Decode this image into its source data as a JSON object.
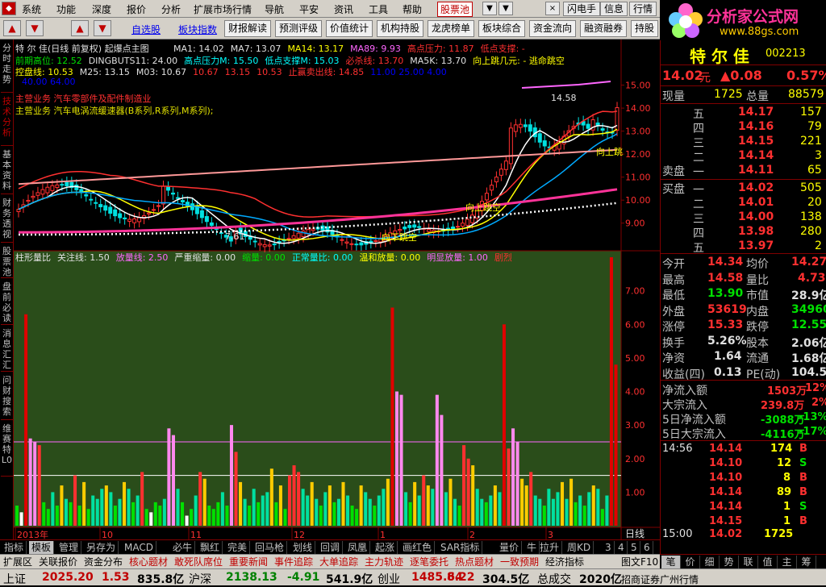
{
  "menu": [
    "系统",
    "功能",
    "深度",
    "报价",
    "分析",
    "扩展市场行情",
    "导航",
    "平安",
    "资讯",
    "工具",
    "帮助"
  ],
  "menu_highlight": "股票池",
  "right_menu": [
    "闪电手",
    "信息",
    "行情"
  ],
  "window_buttons": [
    "▼",
    "▼",
    "×"
  ],
  "logo": {
    "brand": "分析家公式网",
    "url": "www.88gs.com"
  },
  "toolbar": {
    "links": [
      "自选股",
      "板块指数"
    ],
    "buttons": [
      "财报解读",
      "预测评级",
      "价值统计",
      "机构持股",
      "龙虎榜单",
      "板块综合",
      "资金流向",
      "融资融券",
      "持股变"
    ]
  },
  "left_tabs": [
    {
      "label": "分时走势",
      "active": false
    },
    {
      "label": "技术分析",
      "active": true
    },
    {
      "label": "基本资料",
      "active": false
    },
    {
      "label": "财务透视",
      "active": false
    },
    {
      "label": "股票池",
      "active": false
    },
    {
      "label": "盘前必读",
      "active": false
    },
    {
      "label": "消息汇汇",
      "active": false
    },
    {
      "label": "问财搜索",
      "active": false
    },
    {
      "label": "维赛特L0",
      "active": false
    }
  ],
  "main_chart": {
    "title": "特 尔 佳(日线 前复权) 起爆点主图",
    "legend1": [
      {
        "t": "MA1: 14.02",
        "c": "#e0e0e0"
      },
      {
        "t": "MA7: 13.07",
        "c": "#e0e0e0"
      },
      {
        "t": "MA14: 13.17",
        "c": "#ffff00"
      },
      {
        "t": "MA89: 9.93",
        "c": "#ff66ff"
      },
      {
        "t": "高点压力: 11.87",
        "c": "#ff3030"
      },
      {
        "t": "低点支撑: -",
        "c": "#ff3030"
      }
    ],
    "legend2": [
      {
        "t": "前期高位: 12.52",
        "c": "#00e000"
      },
      {
        "t": "DINGBUTS11: 24.00",
        "c": "#e0e0e0"
      },
      {
        "t": "高点压力M: 15.50",
        "c": "#00ffff"
      },
      {
        "t": "低点支撑M: 15.03",
        "c": "#00ffff"
      },
      {
        "t": "必杀线: 13.70",
        "c": "#ff3030"
      },
      {
        "t": "MA5K: 13.70",
        "c": "#e0e0e0"
      },
      {
        "t": "向上跳几元: - 逃命跳空",
        "c": "#ffff00"
      }
    ],
    "legend3": [
      {
        "t": "控盘线: 10.53",
        "c": "#ffff00"
      },
      {
        "t": "M25: 13.15",
        "c": "#e0e0e0"
      },
      {
        "t": "M03: 10.67",
        "c": "#e0e0e0"
      },
      {
        "t": "10.67",
        "c": "#ff3030"
      },
      {
        "t": "13.15",
        "c": "#ff3030"
      },
      {
        "t": "10.53",
        "c": "#ff3030"
      },
      {
        "t": "止赢卖出线: 14.85",
        "c": "#ff3030"
      },
      {
        "t": "11.00 25.00 4.00",
        "c": "#0000ff"
      }
    ],
    "legend4": {
      "t": "40.00 64.00",
      "c": "#0000ff"
    },
    "note1": "主营业务 汽车电涡流缓速器(B系列,R系列,M系列);",
    "note2": "主营业务 汽车零部件及配件制造业",
    "y_labels": [
      "15.00",
      "14.00",
      "13.00",
      "12.00",
      "11.00",
      "10.00",
      "9.00"
    ],
    "annot": {
      "high": "14.58",
      "low": "7.61",
      "up": "向上跳空",
      "up2": "向上跳",
      "down": "向下跳空"
    }
  },
  "sub_chart": {
    "legend": [
      {
        "t": "柱形量比",
        "c": "#e0e0e0"
      },
      {
        "t": "关注线: 1.50",
        "c": "#e0e0e0"
      },
      {
        "t": "放量线: 2.50",
        "c": "#ff66ff"
      },
      {
        "t": "严重缩量: 0.00",
        "c": "#e0e0e0"
      },
      {
        "t": "缩量: 0.00",
        "c": "#00e000"
      },
      {
        "t": "正常量比: 0.00",
        "c": "#00ffff"
      },
      {
        "t": "温和放量: 0.00",
        "c": "#ffff00"
      },
      {
        "t": "明显放量: 1.00",
        "c": "#ff66ff"
      },
      {
        "t": "剧烈",
        "c": "#ff3030"
      }
    ],
    "y_labels": [
      "7.00",
      "6.00",
      "5.00",
      "4.00",
      "3.00",
      "2.00",
      "1.00"
    ],
    "x_labels": [
      "2013年",
      "10",
      "11",
      "12",
      "1",
      "2",
      "3"
    ],
    "x_unit": "日线"
  },
  "chart_data": {
    "type": "bar",
    "title": "柱形量比",
    "ylim": [
      0,
      8
    ],
    "values": [
      0.6,
      0.4,
      6.3,
      2.6,
      2.5,
      2.4,
      0.7,
      0.5,
      1.0,
      0.6,
      1.2,
      0.8,
      0.7,
      1.5,
      0.6,
      1.3,
      0.5,
      0.9,
      0.8,
      1.1,
      1.2,
      1.0,
      0.6,
      0.8,
      1.3,
      1.1,
      0.7,
      0.9,
      1.6,
      0.5,
      0.4,
      0.7,
      0.6,
      0.8,
      2.9,
      2.7,
      1.1,
      0.7,
      0.3,
      0.5,
      0.9,
      1.6,
      1.4,
      0.6,
      0.5,
      0.7,
      1.0,
      0.6,
      3.0,
      2.2,
      1.3,
      0.8,
      0.6,
      1.1,
      0.7,
      0.9,
      1.0,
      1.7,
      0.7,
      1.2,
      0.5,
      1.5,
      1.8,
      1.6,
      1.1,
      0.9,
      1.3,
      0.8,
      0.6,
      1.0,
      1.2,
      0.7,
      0.8,
      1.3,
      0.9,
      0.6,
      0.5,
      1.2,
      1.0,
      0.8,
      0.6,
      0.9,
      1.1,
      1.4,
      6.5,
      4.0,
      3.9,
      1.0,
      0.7,
      1.3,
      0.9,
      1.5,
      1.2,
      1.1,
      3.9,
      3.3,
      1.0,
      1.4,
      0.8,
      0.6,
      2.4,
      2.0,
      1.8,
      1.1,
      0.8,
      0.7,
      0.9,
      1.2,
      1.0,
      6.0,
      2.3,
      2.9,
      2.5,
      1.4,
      1.2,
      1.6,
      0.9,
      0.8,
      0.6,
      1.1,
      0.8,
      1.0,
      1.3,
      0.8,
      1.4,
      0.7,
      0.9,
      0.6,
      1.0,
      1.2,
      1.1,
      0.5,
      0.9,
      8.0,
      4.8
    ],
    "lines": [
      {
        "name": "关注线",
        "value": 1.5
      },
      {
        "name": "放量线",
        "value": 2.5
      }
    ]
  },
  "quote": {
    "name": "特 尔 佳",
    "code": "002213",
    "price": "14.02",
    "unit": "元",
    "change": "▲0.08",
    "pct": "0.57%",
    "xianliang_label": "现量",
    "xianliang": "1725",
    "zongliang_label": "总量",
    "zongliang": "88579",
    "sell_label": "卖盘",
    "buy_label": "买盘",
    "sells": [
      {
        "n": "五",
        "p": "14.17",
        "v": "157"
      },
      {
        "n": "四",
        "p": "14.16",
        "v": "79"
      },
      {
        "n": "三",
        "p": "14.15",
        "v": "221"
      },
      {
        "n": "二",
        "p": "14.14",
        "v": "3"
      },
      {
        "n": "一",
        "p": "14.11",
        "v": "65"
      }
    ],
    "buys": [
      {
        "n": "一",
        "p": "14.02",
        "v": "505"
      },
      {
        "n": "二",
        "p": "14.01",
        "v": "20"
      },
      {
        "n": "三",
        "p": "14.00",
        "v": "138"
      },
      {
        "n": "四",
        "p": "13.98",
        "v": "280"
      },
      {
        "n": "五",
        "p": "13.97",
        "v": "2"
      }
    ],
    "stats": [
      {
        "l1": "今开",
        "v1": "14.34",
        "c1": "red",
        "l2": "均价",
        "v2": "14.27",
        "c2": "red"
      },
      {
        "l1": "最高",
        "v1": "14.58",
        "c1": "red",
        "l2": "量比",
        "v2": "4.73",
        "c2": "red"
      },
      {
        "l1": "最低",
        "v1": "13.90",
        "c1": "grn",
        "l2": "市值",
        "v2": "28.9亿",
        "c2": "wht"
      },
      {
        "l1": "外盘",
        "v1": "53619",
        "c1": "red",
        "l2": "内盘",
        "v2": "34960",
        "c2": "grn"
      },
      {
        "l1": "涨停",
        "v1": "15.33",
        "c1": "red",
        "l2": "跌停",
        "v2": "12.55",
        "c2": "grn"
      },
      {
        "l1": "换手",
        "v1": "5.26%",
        "c1": "wht",
        "l2": "股本",
        "v2": "2.06亿",
        "c2": "wht"
      },
      {
        "l1": "净资",
        "v1": "1.64",
        "c1": "wht",
        "l2": "流通",
        "v2": "1.68亿",
        "c2": "wht"
      },
      {
        "l1": "收益(四)",
        "v1": "0.13",
        "c1": "wht",
        "l2": "PE(动)",
        "v2": "104.5",
        "c2": "wht"
      }
    ],
    "flows": [
      {
        "l": "净流入额",
        "v": "1503万",
        "p": "12%",
        "c": "red"
      },
      {
        "l": "大宗流入",
        "v": "239.8万",
        "p": "2%",
        "c": "red"
      },
      {
        "l": "5日净流入额",
        "v": "-3088万",
        "p": "-13%",
        "c": "grn"
      },
      {
        "l": "5日大宗流入",
        "v": "-4116万",
        "p": "-17%",
        "c": "grn"
      }
    ],
    "ticks": [
      {
        "t": "14:56",
        "p": "14.14",
        "v": "174",
        "d": "B",
        "dc": "red"
      },
      {
        "t": "",
        "p": "14.10",
        "v": "12",
        "d": "S",
        "dc": "grn"
      },
      {
        "t": "",
        "p": "14.10",
        "v": "8",
        "d": "B",
        "dc": "red"
      },
      {
        "t": "",
        "p": "14.14",
        "v": "89",
        "d": "B",
        "dc": "red"
      },
      {
        "t": "",
        "p": "14.14",
        "v": "1",
        "d": "S",
        "dc": "grn"
      },
      {
        "t": "",
        "p": "14.15",
        "v": "1",
        "d": "B",
        "dc": "red"
      },
      {
        "t": "15:00",
        "p": "14.02",
        "v": "1725",
        "d": "",
        "dc": "red"
      }
    ]
  },
  "bottom_tabs": [
    {
      "l": "指标",
      "on": false
    },
    {
      "l": "模板",
      "on": true
    },
    {
      "l": "管理",
      "on": false
    },
    {
      "l": "另存为",
      "on": false
    },
    {
      "l": "MACD",
      "on": false
    },
    {
      "l": "必牛",
      "on": false
    },
    {
      "l": "飘红",
      "on": false
    },
    {
      "l": "完美",
      "on": false
    },
    {
      "l": "回马枪",
      "on": false
    },
    {
      "l": "划线",
      "on": false
    },
    {
      "l": "回调",
      "on": false
    },
    {
      "l": "凤凰",
      "on": false
    },
    {
      "l": "起涨",
      "on": false
    },
    {
      "l": "画红色",
      "on": false
    },
    {
      "l": "SAR指标",
      "on": false
    },
    {
      "l": "量价",
      "on": false
    },
    {
      "l": "牛",
      "on": false
    },
    {
      "l": "拉升",
      "on": false
    },
    {
      "l": "周KD",
      "on": false
    },
    {
      "l": "3",
      "on": false
    },
    {
      "l": "4",
      "on": false
    },
    {
      "l": "5",
      "on": false
    },
    {
      "l": "6",
      "on": false
    }
  ],
  "bar2": [
    "扩展区",
    "关联报价",
    "资金分布",
    "核心题材",
    "敢死队席位",
    "重要新闻",
    "事件追踪",
    "大单追踪",
    "主力轨迹",
    "逐笔委托",
    "热点题材",
    "一致预期",
    "经济指标"
  ],
  "bar2_right": "图文F10",
  "rp_tabs": [
    "笔",
    "价",
    "细",
    "势",
    "联",
    "值",
    "主",
    "筹"
  ],
  "status": {
    "sh_label": "上证",
    "sh": "2025.20",
    "sh_chg": "1.53",
    "sh_amt": "835.8亿",
    "hs_label": "沪深",
    "hs": "2138.13",
    "hs_chg": "-4.91",
    "hs_amt": "541.9亿",
    "cy_label": "创业",
    "cy": "1485.64",
    "cy_chg": "8.22",
    "cy_amt": "304.5亿",
    "total_label": "总成交",
    "total": "2020亿",
    "broker": "招商证券广州行情"
  },
  "colors": {
    "up": "#ff3030",
    "down": "#00e000",
    "bg": "#000000",
    "border": "#800000"
  }
}
